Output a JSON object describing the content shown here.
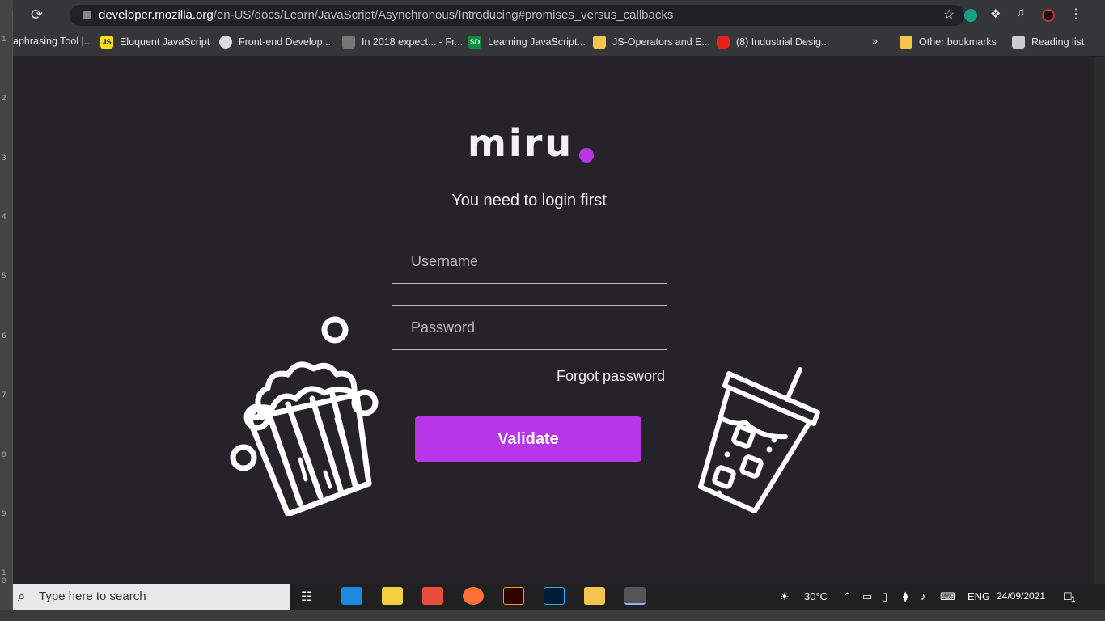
{
  "browser": {
    "url_host": "developer.mozilla.org",
    "url_path": "/en-US/docs/Learn/JavaScript/Asynchronous/Introducing#promises_versus_callbacks",
    "bookmarks": [
      {
        "label": "aphrasing Tool |...",
        "icon": "bookmark-icon"
      },
      {
        "label": "Eloquent JavaScript",
        "icon": "js-icon"
      },
      {
        "label": "Front-end Develop...",
        "icon": "globe-icon"
      },
      {
        "label": "In 2018 expect... - Fr...",
        "icon": "book-icon"
      },
      {
        "label": "Learning JavaScript...",
        "icon": "sd-icon"
      },
      {
        "label": "JS-Operators and E...",
        "icon": "folder-icon"
      },
      {
        "label": "(8) Industrial Desig...",
        "icon": "youtube-icon"
      },
      {
        "label": "»",
        "icon": "more-icon"
      },
      {
        "label": "Other bookmarks",
        "icon": "folder-icon"
      },
      {
        "label": "Reading list",
        "icon": "reading-list-icon"
      }
    ]
  },
  "app": {
    "logo_text": "miru",
    "accent_color": "#b935e8",
    "subtitle": "You need to login first",
    "username_placeholder": "Username",
    "password_placeholder": "Password",
    "forgot_label": "Forgot password",
    "validate_label": "Validate"
  },
  "taskbar": {
    "search_placeholder": "Type here to search",
    "weather": "30°C",
    "language": "ENG",
    "date": "24/09/2021",
    "notification_count": "1"
  }
}
